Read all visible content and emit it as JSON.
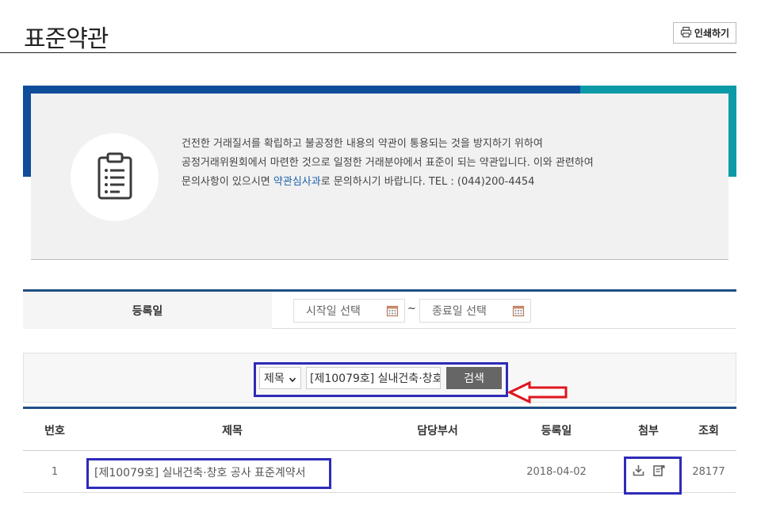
{
  "header": {
    "title": "표준약관",
    "print_label": "인쇄하기"
  },
  "info": {
    "line1": "건전한 거래질서를 확립하고 불공정한 내용의 약관이 통용되는 것을 방지하기 위하여",
    "line2": "공정거래위원회에서 마련한 것으로 일정한 거래분야에서 표준이 되는 약관입니다. 이와 관련하여",
    "line3_prefix": "문의사항이 있으시면 ",
    "line3_link": "약관심사과",
    "line3_suffix": "로 문의하시기 바랍니다. TEL : (044)200-4454"
  },
  "date_filter": {
    "label": "등록일",
    "start_placeholder": "시작일 선택",
    "separator": "~",
    "end_placeholder": "종료일 선택"
  },
  "search": {
    "field_selected": "제목",
    "query_value": "[제10079호] 실내건축·창호",
    "button_label": "검색"
  },
  "table": {
    "columns": [
      "번호",
      "제목",
      "담당부서",
      "등록일",
      "첨부",
      "조회"
    ],
    "rows": [
      {
        "no": "1",
        "title": "[제10079호] 실내건축·창호 공사 표준계약서",
        "dept": "",
        "date": "2018-04-02",
        "attachments": [
          "download-icon",
          "view-document-icon"
        ],
        "views": "28177"
      }
    ]
  },
  "colors": {
    "accent_blue": "#0f4c9a",
    "accent_teal": "#0d9aa8",
    "highlight_box": "#2e2bb8",
    "annotation_arrow": "#e0141e"
  }
}
